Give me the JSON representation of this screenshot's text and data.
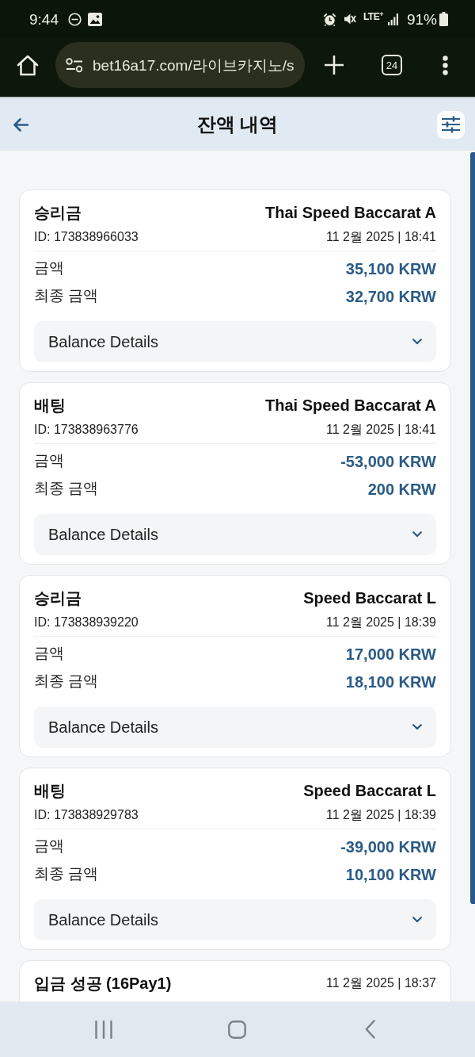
{
  "status_bar": {
    "time": "9:44",
    "network": "LTE$^{+}$",
    "battery": "91%"
  },
  "browser": {
    "url": "bet16a17.com/라이브카지노/s",
    "tab_count": "24"
  },
  "header": {
    "title": "잔액 내역"
  },
  "transactions": [
    {
      "kind": "game",
      "title": "승리금",
      "game": "Thai Speed Baccarat A",
      "id": "ID: 173838966033",
      "datetime": "11 2월 2025 | 18:41",
      "rows": [
        {
          "label": "금액",
          "value": "35,100 KRW"
        },
        {
          "label": "최종 금액",
          "value": "32,700 KRW"
        }
      ],
      "details": {
        "label": "Balance Details",
        "expanded": false
      }
    },
    {
      "kind": "game",
      "title": "배팅",
      "game": "Thai Speed Baccarat A",
      "id": "ID: 173838963776",
      "datetime": "11 2월 2025 | 18:41",
      "rows": [
        {
          "label": "금액",
          "value": "-53,000 KRW"
        },
        {
          "label": "최종 금액",
          "value": "200 KRW"
        }
      ],
      "details": {
        "label": "Balance Details",
        "expanded": false
      }
    },
    {
      "kind": "game",
      "title": "승리금",
      "game": "Speed Baccarat L",
      "id": "ID: 173838939220",
      "datetime": "11 2월 2025 | 18:39",
      "rows": [
        {
          "label": "금액",
          "value": "17,000 KRW"
        },
        {
          "label": "최종 금액",
          "value": "18,100 KRW"
        }
      ],
      "details": {
        "label": "Balance Details",
        "expanded": false
      }
    },
    {
      "kind": "game",
      "title": "배팅",
      "game": "Speed Baccarat L",
      "id": "ID: 173838929783",
      "datetime": "11 2월 2025 | 18:39",
      "rows": [
        {
          "label": "금액",
          "value": "-39,000 KRW"
        },
        {
          "label": "최종 금액",
          "value": "10,100 KRW"
        }
      ],
      "details": {
        "label": "Balance Details",
        "expanded": false
      }
    },
    {
      "kind": "deposit",
      "title": "입금 성공 (16Pay1)",
      "datetime": "11 2월 2025 | 18:37"
    }
  ]
}
